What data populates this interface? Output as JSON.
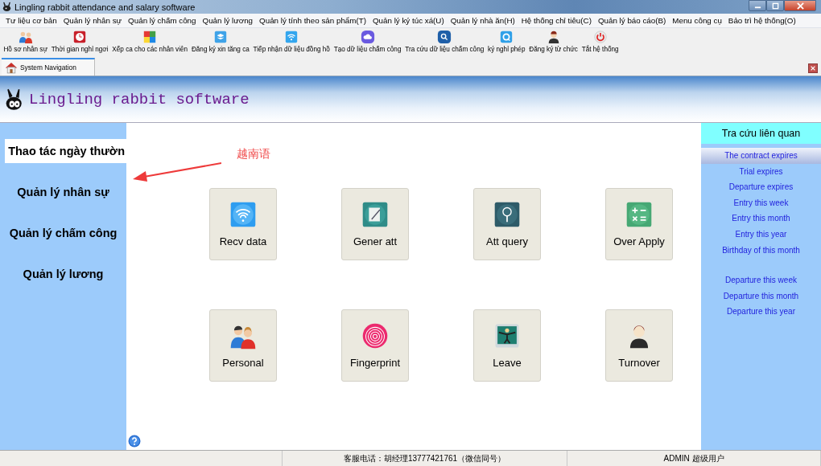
{
  "window": {
    "title": "Lingling rabbit attendance and salary software"
  },
  "menu": [
    "Tư liệu cơ bản",
    "Quản lý nhân sự",
    "Quản lý chấm công",
    "Quản lý lương",
    "Quản lý tính theo sản phẩm(T)",
    "Quản lý ký túc xá(U)",
    "Quản lý nhà ăn(H)",
    "Hệ thống chỉ tiêu(C)",
    "Quản lý báo cáo(B)",
    "Menu công cụ",
    "Bảo trì hệ thống(O)"
  ],
  "toolbar": [
    "Hồ sơ nhân sự",
    "Thời gian nghỉ ngơi",
    "Xếp ca cho các nhân viên",
    "Đăng ký xin tăng ca",
    "Tiếp nhận dữ liệu đồng hồ",
    "Tạo dữ liệu chấm công",
    "Tra cứu dữ liệu chấm công",
    "ký nghỉ phép",
    "Đăng ký từ chức",
    "Tắt hệ thống"
  ],
  "tab": {
    "label": "System Navigation"
  },
  "banner": {
    "title": "Lingling rabbit software"
  },
  "nav": [
    {
      "label": "Thao tác ngày thườn",
      "selected": true
    },
    {
      "label": "Quản lý nhân sự",
      "selected": false
    },
    {
      "label": "Quản lý chấm công",
      "selected": false
    },
    {
      "label": "Quản lý lương",
      "selected": false
    }
  ],
  "annotation": {
    "text": "越南语"
  },
  "tiles": [
    "Recv data",
    "Gener att",
    "Att query",
    "Over Apply",
    "Personal",
    "Fingerprint",
    "Leave",
    "Turnover"
  ],
  "lookup": {
    "title": "Tra cứu liên quan",
    "groups": [
      [
        {
          "label": "The contract expires",
          "selected": true
        },
        {
          "label": "Trial expires",
          "selected": false
        },
        {
          "label": "Departure expires",
          "selected": false
        },
        {
          "label": "Entry this week",
          "selected": false
        },
        {
          "label": "Entry this month",
          "selected": false
        },
        {
          "label": "Entry this year",
          "selected": false
        },
        {
          "label": "Birthday of this month",
          "selected": false
        }
      ],
      [
        {
          "label": "Departure this week",
          "selected": false
        },
        {
          "label": "Departure this month",
          "selected": false
        },
        {
          "label": "Departure this year",
          "selected": false
        }
      ]
    ]
  },
  "status_bar": [
    "客服电话：胡经理13777421761（微信同号）",
    "ADMIN 超级用户"
  ]
}
